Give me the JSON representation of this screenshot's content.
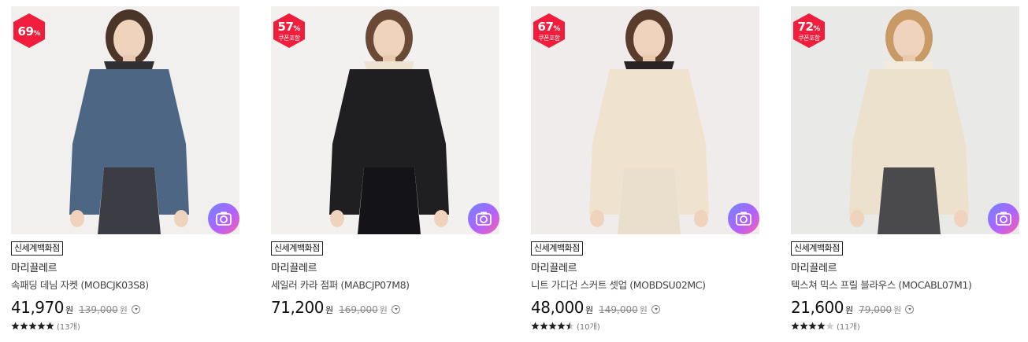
{
  "products": [
    {
      "discount_num": "69",
      "discount_sym": "%",
      "coupon_label": "",
      "store": "신세계백화점",
      "brand": "마리끌레르",
      "name": "속패딩 데님 자켓 (MOBCJK03S8)",
      "price": "41,970",
      "currency": "원",
      "original_price": "139,000",
      "rating": 5,
      "review_count": "(13개)",
      "photo": {
        "bg": "#f1f0ee",
        "top": "#4d6684",
        "hood": "#2f2f34",
        "bottom": "#3c3c44",
        "hair": "#4a3528"
      }
    },
    {
      "discount_num": "57",
      "discount_sym": "%",
      "coupon_label": "쿠폰포함",
      "store": "신세계백화점",
      "brand": "마리끌레르",
      "name": "세일러 카라 점퍼 (MABCJP07M8)",
      "price": "71,200",
      "currency": "원",
      "original_price": "169,000",
      "rating": 0,
      "review_count": "",
      "photo": {
        "bg": "#f2f1ef",
        "top": "#1f1f22",
        "hood": "#eee3d2",
        "bottom": "#141418",
        "hair": "#6a4a36"
      }
    },
    {
      "discount_num": "67",
      "discount_sym": "%",
      "coupon_label": "쿠폰포함",
      "store": "신세계백화점",
      "brand": "마리끌레르",
      "name": "니트 가디건 스커트 셋업 (MOBDSU02MC)",
      "price": "48,000",
      "currency": "원",
      "original_price": "149,000",
      "rating": 4.5,
      "review_count": "(10개)",
      "photo": {
        "bg": "#efeceb",
        "top": "#efe3d0",
        "hood": "#2a2324",
        "bottom": "#eadfcd",
        "hair": "#5a3c2c"
      }
    },
    {
      "discount_num": "72",
      "discount_sym": "%",
      "coupon_label": "쿠폰포함",
      "store": "신세계백화점",
      "brand": "마리끌레르",
      "name": "텍스쳐 믹스 프릴 블라우스 (MOCABL07M1)",
      "price": "21,600",
      "currency": "원",
      "original_price": "79,000",
      "rating": 4,
      "review_count": "(11개)",
      "photo": {
        "bg": "#e9e9e7",
        "top": "#ece1cc",
        "hood": "#f3ebdc",
        "bottom": "#4a4a4c",
        "hair": "#c79a66"
      }
    }
  ],
  "colors": {
    "badge_red": "#f01e3c",
    "star": "#222222",
    "star_empty": "#cccccc"
  },
  "icons": {
    "badge": "hexagon-badge",
    "camera": "camera-icon",
    "info": "chevron-down-circle-icon",
    "star": "star-icon"
  }
}
